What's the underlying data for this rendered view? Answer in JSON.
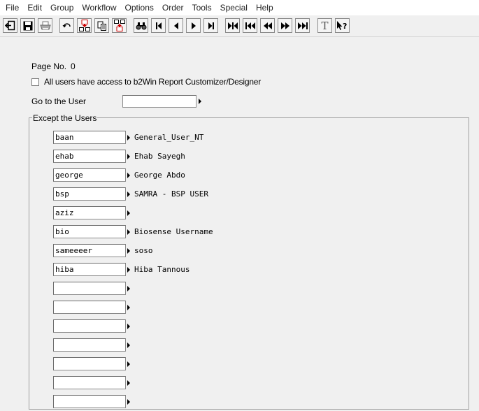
{
  "menu": [
    "File",
    "Edit",
    "Group",
    "Workflow",
    "Options",
    "Order",
    "Tools",
    "Special",
    "Help"
  ],
  "toolbar": {
    "icons": [
      "exit-icon",
      "save-icon",
      "print-icon",
      "undo-icon",
      "insert-record-icon",
      "copy-icon",
      "delete-record-icon",
      "find-icon",
      "first-record-icon",
      "previous-record-icon",
      "next-record-icon",
      "last-record-icon",
      "first-group-icon",
      "previous-group-icon",
      "previous-page-icon",
      "next-page-icon",
      "last-group-icon",
      "text-icon",
      "help-icon"
    ],
    "text_glyph": "T",
    "help_glyph": "?"
  },
  "form": {
    "page_label": "Page No.",
    "page_value": "0",
    "all_users_label": "All users have access to b2Win Report Customizer/Designer",
    "all_users_checked": false,
    "go_to_user_label": "Go to the User",
    "go_to_user_value": "",
    "except_group_label": "Except the Users"
  },
  "users": [
    {
      "code": "baan",
      "name": "General_User_NT"
    },
    {
      "code": "ehab",
      "name": "Ehab Sayegh"
    },
    {
      "code": "george",
      "name": "George Abdo"
    },
    {
      "code": "bsp",
      "name": "SAMRA - BSP USER"
    },
    {
      "code": "aziz",
      "name": ""
    },
    {
      "code": "bio",
      "name": "Biosense Username"
    },
    {
      "code": "sameeeer",
      "name": "soso"
    },
    {
      "code": "hiba",
      "name": "Hiba Tannous"
    },
    {
      "code": "",
      "name": ""
    },
    {
      "code": "",
      "name": ""
    },
    {
      "code": "",
      "name": ""
    },
    {
      "code": "",
      "name": ""
    },
    {
      "code": "",
      "name": ""
    },
    {
      "code": "",
      "name": ""
    },
    {
      "code": "",
      "name": ""
    }
  ]
}
